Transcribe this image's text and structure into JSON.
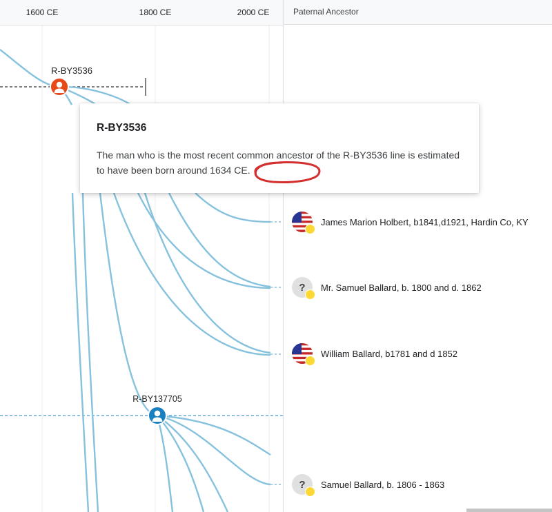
{
  "timeline": {
    "ticks": [
      "1600 CE",
      "1800 CE",
      "2000 CE"
    ]
  },
  "column_header": "Paternal Ancestor",
  "nodes": [
    {
      "id": "R-BY3536",
      "color": "#e64a19"
    },
    {
      "id": "R-BY137705",
      "color": "#1a7fc1"
    }
  ],
  "tooltip": {
    "title": "R-BY3536",
    "body_before": "The man who is the most recent common ancestor of the R-BY3536 line is estimated to have been born around ",
    "body_year": "1634 CE",
    "body_after": "."
  },
  "ancestors": [
    {
      "name": "James Marion Holbert, b1841,d1921, Hardin Co, KY",
      "badge": "us-flag-icon"
    },
    {
      "name": "Mr. Samuel Ballard, b. 1800 and d. 1862",
      "badge": "unknown-icon"
    },
    {
      "name": "William Ballard, b1781 and d 1852",
      "badge": "us-flag-icon"
    },
    {
      "name": "Samuel Ballard, b. 1806 - 1863",
      "badge": "unknown-icon"
    }
  ],
  "colors": {
    "branch_line": "#86c2de",
    "annotation": "#d32f2f",
    "coin": "#fdd835"
  }
}
